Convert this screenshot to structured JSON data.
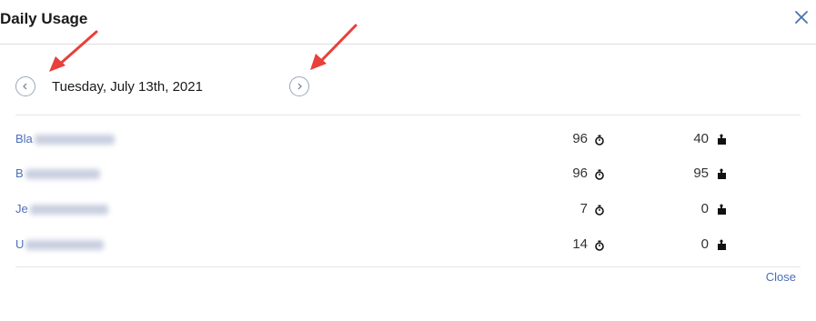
{
  "dialog": {
    "title": "Daily Usage",
    "close_icon": "close-x-icon",
    "accent_color": "#4a6fb5"
  },
  "navigation": {
    "date": "Tuesday, July 13th, 2021",
    "prev_icon": "chevron-left-icon",
    "next_icon": "chevron-right-icon"
  },
  "rows": [
    {
      "name_visible": "Bla",
      "value1": "96",
      "value2": "40"
    },
    {
      "name_visible": "B",
      "value1": "96",
      "value2": "95"
    },
    {
      "name_visible": "Je",
      "value1": "7",
      "value2": "0"
    },
    {
      "name_visible": "U",
      "value1": "14",
      "value2": "0"
    }
  ],
  "icons": {
    "column1": "stopwatch-icon",
    "column2": "puzzle-piece-icon"
  },
  "footer": {
    "close_label": "Close"
  },
  "annotations": {
    "arrow_color": "#e8403a"
  }
}
